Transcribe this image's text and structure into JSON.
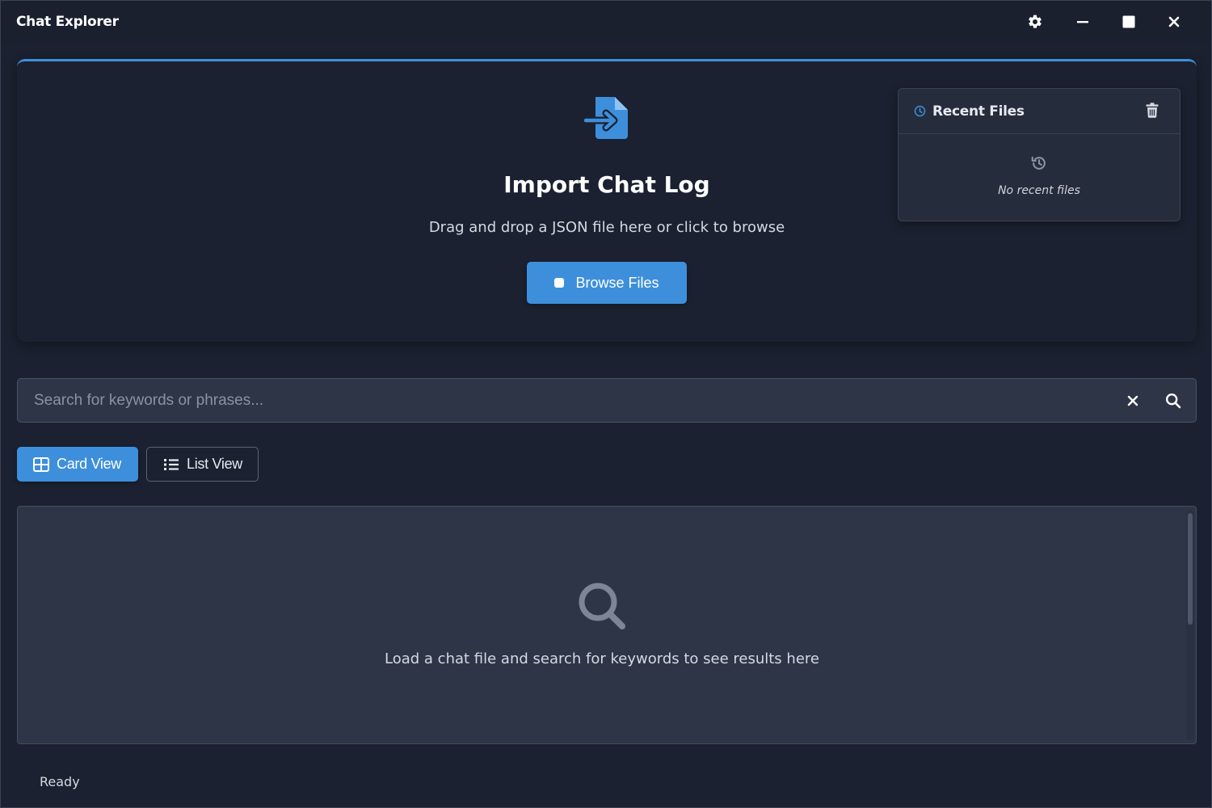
{
  "window": {
    "title": "Chat Explorer",
    "controls": [
      "settings-icon",
      "minimize-icon",
      "maximize-icon",
      "close-icon"
    ]
  },
  "import_panel": {
    "icon": "file-import-icon",
    "title": "Import Chat Log",
    "subtitle": "Drag and drop a JSON file here or click to browse",
    "browse_label": "Browse Files"
  },
  "recent_files": {
    "title": "Recent Files",
    "empty_message": "No recent files",
    "icons": [
      "clock-icon",
      "trash-icon",
      "history-icon"
    ]
  },
  "search": {
    "placeholder": "Search for keywords or phrases...",
    "value": ""
  },
  "views": {
    "card_label": "Card View",
    "list_label": "List View",
    "active": "card"
  },
  "results": {
    "empty_message": "Load a chat file and search for keywords to see results here"
  },
  "status": {
    "text": "Ready"
  },
  "colors": {
    "accent": "#3e8fdb",
    "background": "#1b2130",
    "panel": "#2d3547"
  }
}
